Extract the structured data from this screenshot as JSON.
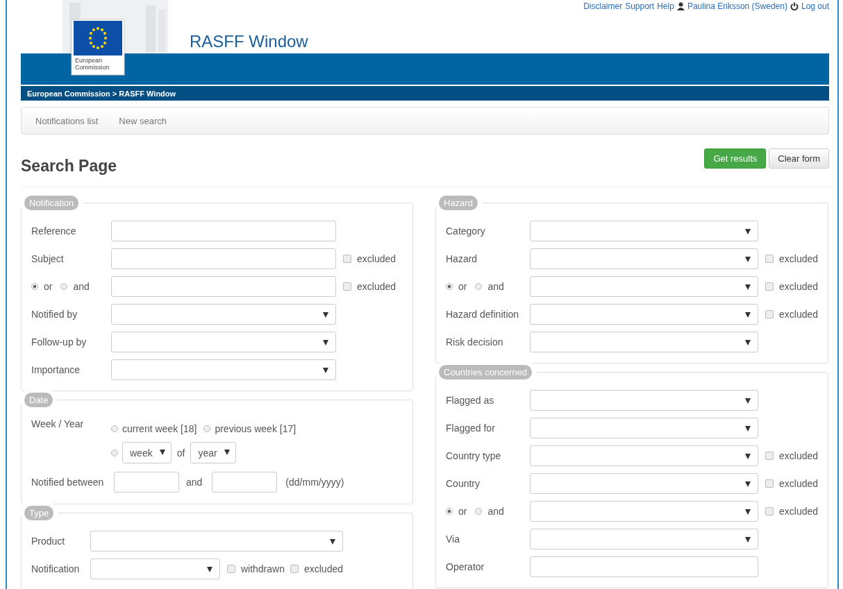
{
  "header": {
    "links": [
      "Disclaimer",
      "Support",
      "Help"
    ],
    "user": "Paulina Eriksson (Sweden)",
    "logout": "Log out",
    "logo_text": "European Commission",
    "title": "RASFF Window",
    "breadcrumb": "European Commission > RASFF Window"
  },
  "nav": [
    {
      "label": "Notifications list"
    },
    {
      "label": "New search"
    }
  ],
  "page_title": "Search Page",
  "buttons": [
    {
      "label": "Get results",
      "kind": "primary"
    },
    {
      "label": "Clear form",
      "kind": "default"
    }
  ],
  "columns": [
    [
      {
        "legend": "Notification",
        "kind": "rows",
        "rows": [
          {
            "kind": "label",
            "label": "Reference",
            "field": {
              "kind": "text"
            },
            "checks": []
          },
          {
            "kind": "label",
            "label": "Subject",
            "field": {
              "kind": "text"
            },
            "checks": [
              {
                "label": "excluded",
                "checked": false
              }
            ]
          },
          {
            "kind": "andor",
            "options": [
              {
                "label": "or",
                "selected": true
              },
              {
                "label": "and",
                "selected": false
              }
            ],
            "field": {
              "kind": "text"
            },
            "checks": [
              {
                "label": "excluded",
                "checked": false
              }
            ]
          },
          {
            "kind": "label",
            "label": "Notified by",
            "field": {
              "kind": "select"
            },
            "checks": []
          },
          {
            "kind": "label",
            "label": "Follow-up by",
            "field": {
              "kind": "select"
            },
            "checks": []
          },
          {
            "kind": "label",
            "label": "Importance",
            "field": {
              "kind": "select"
            },
            "checks": []
          }
        ]
      },
      {
        "legend": "Date",
        "kind": "date",
        "week_label": "Week / Year",
        "week_options": [
          {
            "label": "current week [18]",
            "selected": false
          },
          {
            "label": "previous week [17]",
            "selected": false
          }
        ],
        "custom": {
          "selected": false,
          "week": "week",
          "of": "of",
          "year": "year"
        },
        "between_label": "Notified between",
        "and": "and",
        "format": "(dd/mm/yyyy)"
      },
      {
        "legend": "Type",
        "kind": "inline",
        "rows": [
          {
            "kind": "label",
            "label": "Product",
            "field": {
              "kind": "select"
            },
            "checks": []
          },
          {
            "kind": "label",
            "label": "Notification",
            "field": {
              "kind": "select"
            },
            "checks": [
              {
                "label": "withdrawn",
                "checked": false
              },
              {
                "label": "excluded",
                "checked": false
              }
            ]
          }
        ]
      }
    ],
    [
      {
        "legend": "Hazard",
        "kind": "rows",
        "rows": [
          {
            "kind": "label",
            "label": "Category",
            "field": {
              "kind": "select"
            },
            "checks": []
          },
          {
            "kind": "label",
            "label": "Hazard",
            "field": {
              "kind": "select"
            },
            "checks": [
              {
                "label": "excluded",
                "checked": false
              }
            ]
          },
          {
            "kind": "andor",
            "options": [
              {
                "label": "or",
                "selected": true
              },
              {
                "label": "and",
                "selected": false
              }
            ],
            "field": {
              "kind": "select"
            },
            "checks": [
              {
                "label": "excluded",
                "checked": false
              }
            ]
          },
          {
            "kind": "label",
            "label": "Hazard definition",
            "field": {
              "kind": "select"
            },
            "checks": [
              {
                "label": "excluded",
                "checked": false
              }
            ]
          },
          {
            "kind": "label",
            "label": "Risk decision",
            "field": {
              "kind": "select"
            },
            "checks": []
          }
        ]
      },
      {
        "legend": "Countries concerned",
        "kind": "rows",
        "rows": [
          {
            "kind": "label",
            "label": "Flagged as",
            "field": {
              "kind": "select"
            },
            "checks": []
          },
          {
            "kind": "label",
            "label": "Flagged for",
            "field": {
              "kind": "select"
            },
            "checks": []
          },
          {
            "kind": "label",
            "label": "Country type",
            "field": {
              "kind": "select"
            },
            "checks": [
              {
                "label": "excluded",
                "checked": false
              }
            ]
          },
          {
            "kind": "label",
            "label": "Country",
            "field": {
              "kind": "select"
            },
            "checks": [
              {
                "label": "excluded",
                "checked": false
              }
            ]
          },
          {
            "kind": "andor",
            "options": [
              {
                "label": "or",
                "selected": true
              },
              {
                "label": "and",
                "selected": false
              }
            ],
            "field": {
              "kind": "select"
            },
            "checks": [
              {
                "label": "excluded",
                "checked": false
              }
            ]
          },
          {
            "kind": "label",
            "label": "Via",
            "field": {
              "kind": "select"
            },
            "checks": []
          },
          {
            "kind": "label",
            "label": "Operator",
            "field": {
              "kind": "text"
            },
            "checks": []
          }
        ]
      }
    ]
  ]
}
